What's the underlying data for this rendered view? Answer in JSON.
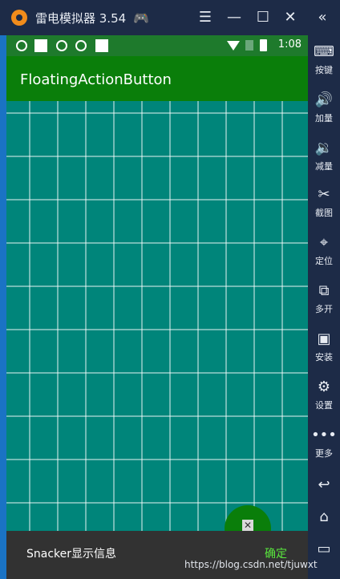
{
  "window": {
    "title": "雷电模拟器 3.54",
    "controls": {
      "menu": "☰",
      "minimize": "—",
      "maximize": "☐",
      "close": "✕",
      "collapse": "«"
    }
  },
  "toolbar": {
    "items": [
      {
        "label": "按键",
        "icon": "keyboard-icon",
        "glyph": "⌨"
      },
      {
        "label": "加量",
        "icon": "volume-up-icon",
        "glyph": "🔊"
      },
      {
        "label": "减量",
        "icon": "volume-down-icon",
        "glyph": "🔉"
      },
      {
        "label": "截图",
        "icon": "scissors-icon",
        "glyph": "✂"
      },
      {
        "label": "定位",
        "icon": "location-pin-icon",
        "glyph": "⌖"
      },
      {
        "label": "多开",
        "icon": "multi-instance-icon",
        "glyph": "⧉"
      },
      {
        "label": "安装",
        "icon": "apk-install-icon",
        "glyph": "▣"
      },
      {
        "label": "设置",
        "icon": "gear-icon",
        "glyph": "⚙"
      },
      {
        "label": "更多",
        "icon": "more-dots-icon",
        "glyph": "•••"
      }
    ],
    "nav": {
      "back": "↩",
      "home": "⌂",
      "recents": "▭"
    }
  },
  "statusbar": {
    "time": "1:08"
  },
  "app": {
    "title": "FloatingActionButton"
  },
  "fab": {
    "glyph": "✕"
  },
  "snackbar": {
    "message": "Snacker显示信息",
    "action": "确定"
  },
  "watermark": "https://blog.csdn.net/tjuwxt",
  "colors": {
    "accent": "#0a7e0a",
    "background": "#00857a",
    "snackbar": "#323232",
    "action": "#59e83d"
  }
}
